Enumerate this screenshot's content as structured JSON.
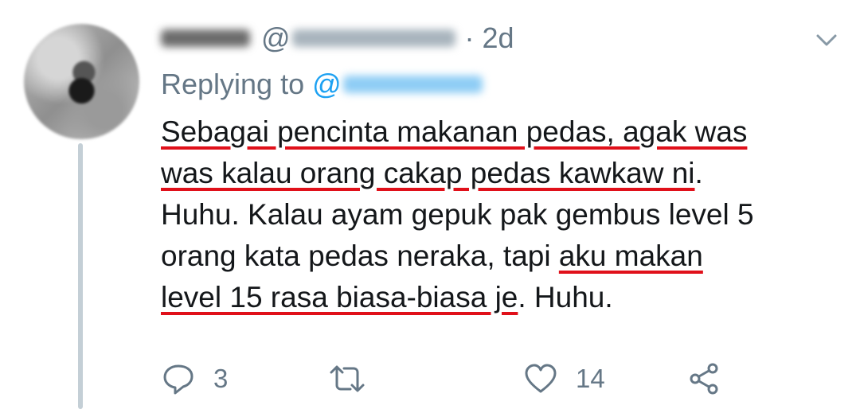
{
  "tweet": {
    "timestamp": "· 2d",
    "reply_prefix": "Replying to",
    "reply_at": "@",
    "handle_at": "@",
    "body": {
      "line1": "Sebagai pencinta makanan pedas, agak was",
      "line2_underlined": "was kalau orang cakap pedas kawkaw ni",
      "line2_rest": ".",
      "line3": "Huhu. Kalau ayam gepuk pak gembus level 5",
      "line4_plain": "orang kata pedas neraka, tapi ",
      "line4_underlined": "aku makan",
      "line5_underlined": "level 15 rasa biasa-biasa je",
      "line5_rest": ". Huhu."
    },
    "actions": {
      "reply_count": "3",
      "retweet_count": "",
      "like_count": "14"
    }
  },
  "colors": {
    "secondary_text": "#657786",
    "link": "#1da1f2",
    "underline": "#e0101a",
    "thread_line": "#c4cfd6"
  },
  "icons": [
    "chevron-down-icon",
    "reply-icon",
    "retweet-icon",
    "like-icon",
    "share-icon"
  ]
}
